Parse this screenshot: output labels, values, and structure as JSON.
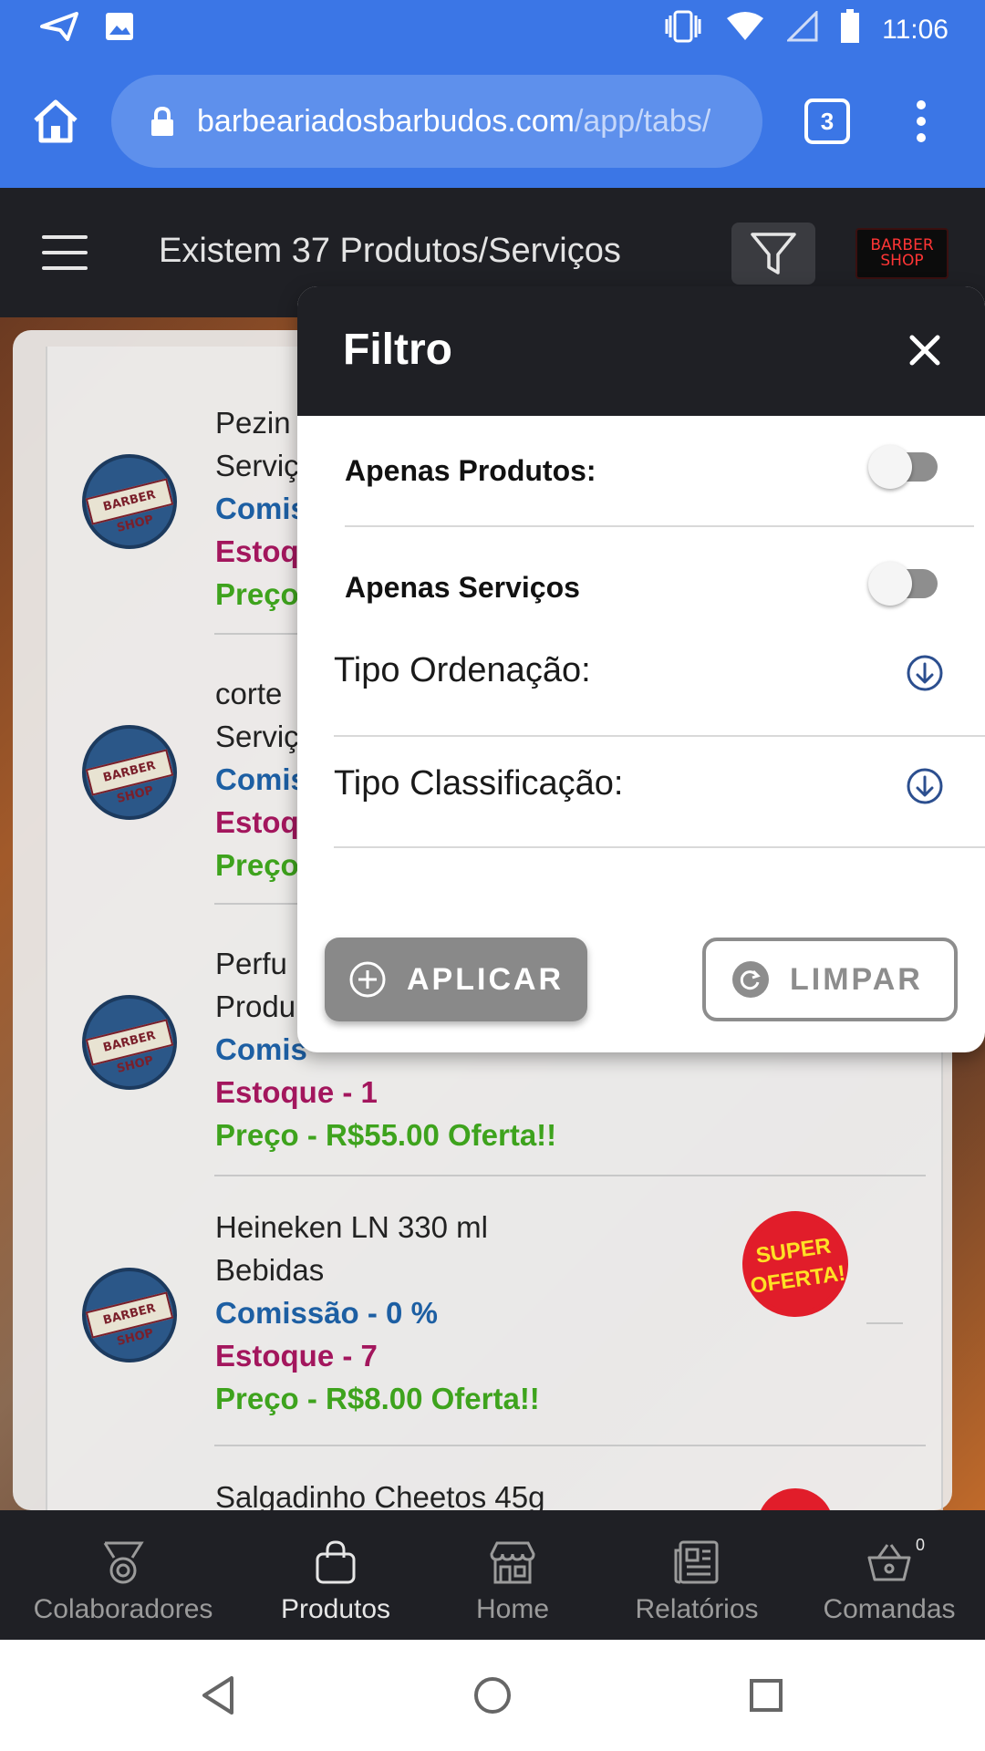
{
  "status_bar": {
    "time": "11:06",
    "icons": [
      "send-icon",
      "image-icon",
      "vibrate-icon",
      "wifi-icon",
      "signal-icon",
      "battery-icon"
    ]
  },
  "browser": {
    "url_host": "barbeariadosbarbudos.com",
    "url_path": "/app/tabs/",
    "tab_count": "3"
  },
  "header": {
    "title": "Existem 37 Produtos/Serviços",
    "logo_text": "BARBER SHOP"
  },
  "list": {
    "avatar_text": "BARBER SHOP",
    "items": [
      {
        "name": "Pezin",
        "category": "Serviç",
        "commission": "Comis",
        "stock": "Estoq",
        "price": "Preço"
      },
      {
        "name": "corte",
        "category": "Serviç",
        "commission": "Comis",
        "stock": "Estoq",
        "price": "Preço"
      },
      {
        "name": "Perfu",
        "category": "Produ",
        "commission": "Comis",
        "stock": "Estoque - 1",
        "price": "Preço - R$55.00 Oferta!!"
      },
      {
        "name": "Heineken LN 330 ml",
        "category": "Bebidas",
        "commission": "Comissão - 0 %",
        "stock": "Estoque - 7",
        "price": "Preço - R$8.00 Oferta!!",
        "badge": "SUPER OFERTA!"
      },
      {
        "name": "Salgadinho Cheetos 45g"
      }
    ]
  },
  "filter": {
    "title": "Filtro",
    "only_products_label": "Apenas Produtos:",
    "only_products": false,
    "only_services_label": "Apenas Serviços",
    "only_services": false,
    "sort_type_label": "Tipo Ordenação:",
    "classification_type_label": "Tipo Classificação:",
    "apply_label": "APLICAR",
    "clear_label": "LIMPAR"
  },
  "tabs": [
    {
      "label": "Colaboradores",
      "icon": "medal-icon"
    },
    {
      "label": "Produtos",
      "icon": "shopping-bag-icon",
      "active": true
    },
    {
      "label": "Home",
      "icon": "store-icon"
    },
    {
      "label": "Relatórios",
      "icon": "newspaper-icon"
    },
    {
      "label": "Comandas",
      "icon": "basket-icon",
      "badge": "0"
    }
  ],
  "colors": {
    "browser_blue": "#3b76e6",
    "app_dark": "#1f2025",
    "commission_blue": "#1d5fa3",
    "stock_magenta": "#a3165d",
    "price_green": "#3ea31d"
  }
}
